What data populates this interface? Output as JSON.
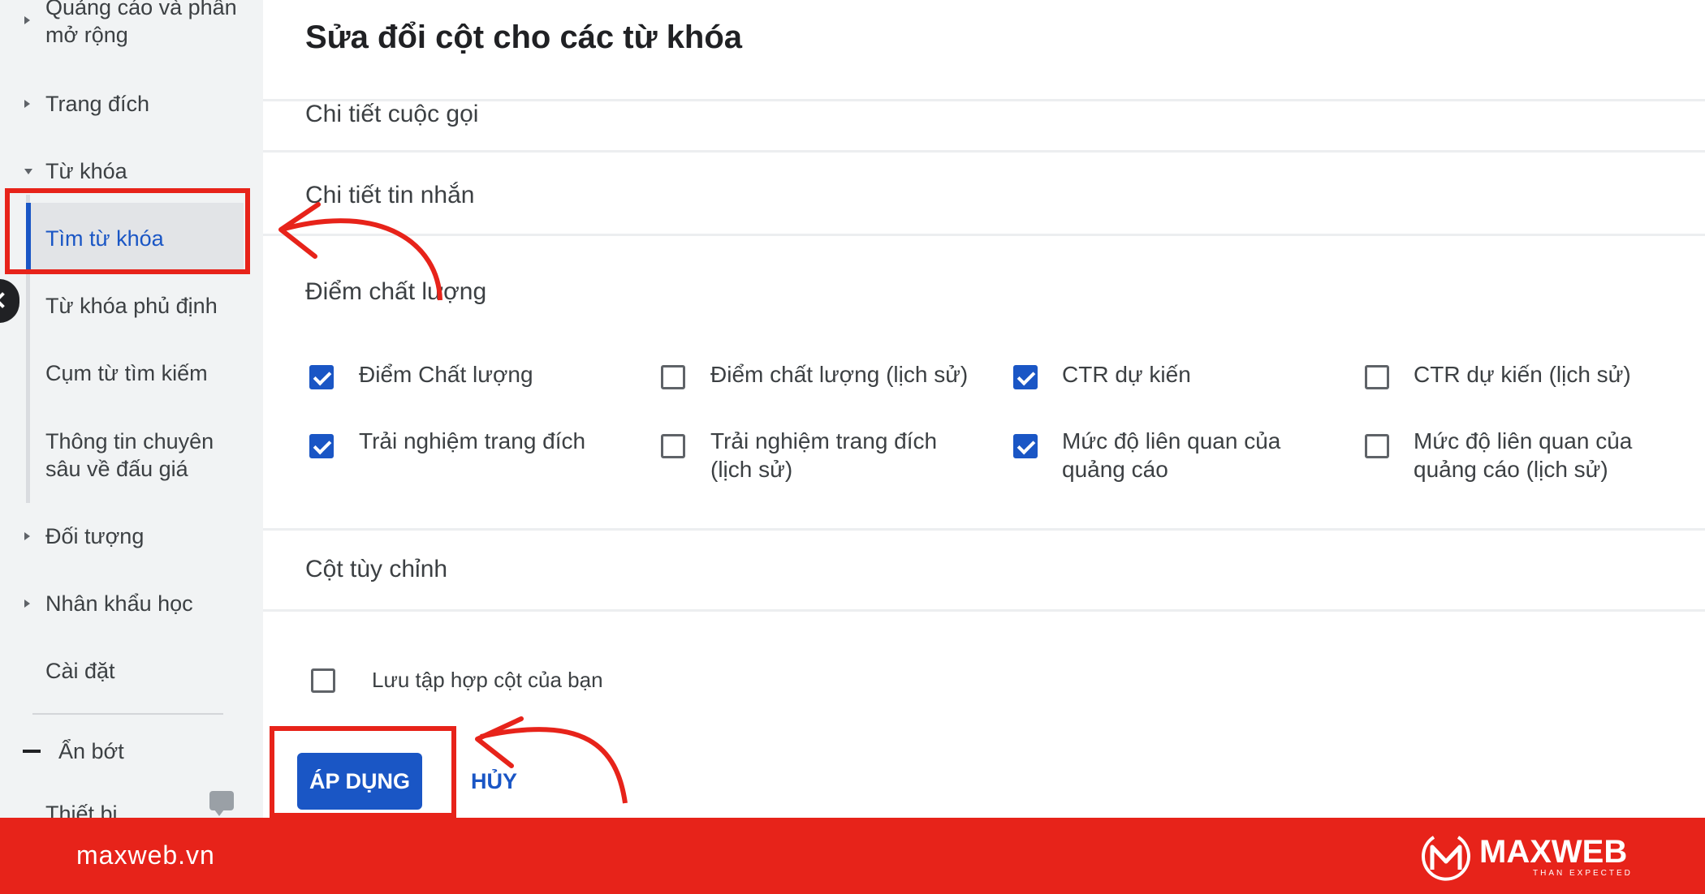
{
  "sidebar": {
    "items": [
      {
        "label": "Quảng cáo và phần\nmở rộng"
      },
      {
        "label": "Trang đích"
      },
      {
        "label": "Từ khóa"
      },
      {
        "label": "Tìm từ khóa"
      },
      {
        "label": "Từ khóa phủ định"
      },
      {
        "label": "Cụm từ tìm kiếm"
      },
      {
        "label": "Thông tin chuyên\nsâu về đấu giá"
      },
      {
        "label": "Đối tượng"
      },
      {
        "label": "Nhân khẩu học"
      },
      {
        "label": "Cài đặt"
      },
      {
        "label": "Ẩn bớt"
      },
      {
        "label": "Thiết bị"
      }
    ]
  },
  "main": {
    "title": "Sửa đổi cột cho các từ khóa",
    "sections": {
      "call_details": "Chi tiết cuộc gọi",
      "message_details": "Chi tiết tin nhắn",
      "quality_score": "Điểm chất lượng",
      "custom_columns": "Cột tùy chỉnh"
    },
    "checkboxes": [
      {
        "label": "Điểm Chất lượng",
        "checked": true
      },
      {
        "label": "Điểm chất lượng (lịch sử)",
        "checked": false
      },
      {
        "label": "CTR dự kiến",
        "checked": true
      },
      {
        "label": "CTR dự kiến (lịch sử)",
        "checked": false
      },
      {
        "label": "Trải nghiệm trang đích",
        "checked": true
      },
      {
        "label": "Trải nghiệm trang đích\n(lịch sử)",
        "checked": false
      },
      {
        "label": "Mức độ liên quan của\nquảng cáo",
        "checked": true
      },
      {
        "label": "Mức độ liên quan của\nquảng cáo (lịch sử)",
        "checked": false
      }
    ],
    "save_set": {
      "label": "Lưu tập hợp cột của bạn",
      "checked": false
    },
    "apply_label": "ÁP DỤNG",
    "cancel_label": "HỦY"
  },
  "footer": {
    "site": "maxweb.vn",
    "logo_text": "MAXWEB",
    "logo_tagline": "THAN EXPECTED"
  },
  "colors": {
    "accent": "#1a56c5",
    "highlight": "#e7231a",
    "footer": "#e7231a"
  }
}
